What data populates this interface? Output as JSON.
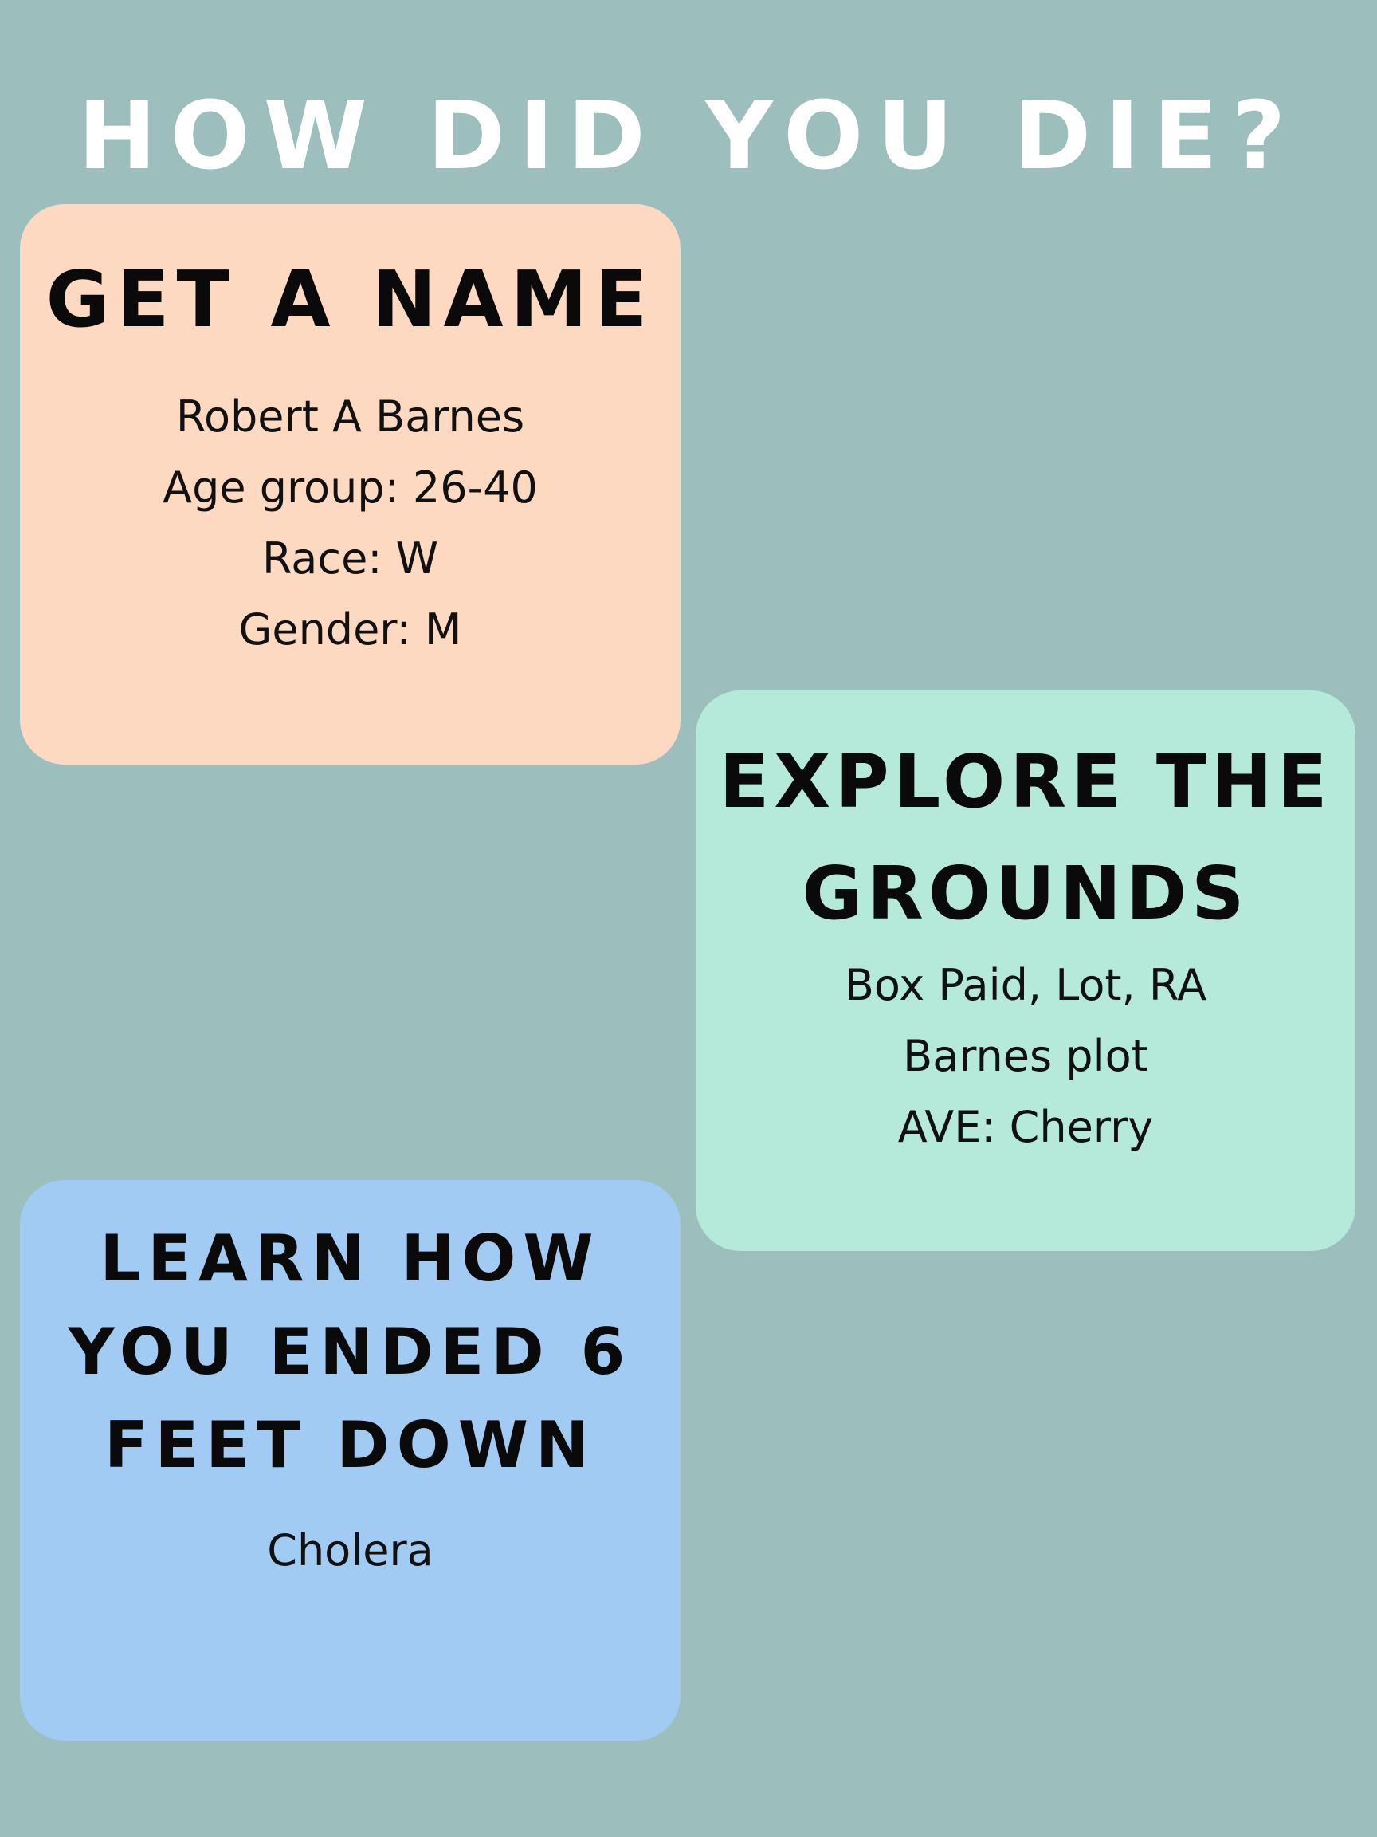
{
  "title": "HOW DID YOU DIE?",
  "cards": [
    {
      "heading": "GET A NAME",
      "lines": [
        "Robert A Barnes",
        "Age group: 26-40",
        "Race: W",
        "Gender: M"
      ],
      "color": "#fdd9c2"
    },
    {
      "heading": "EXPLORE THE\nGROUNDS",
      "lines": [
        "Box Paid, Lot, RA",
        "Barnes plot",
        "AVE: Cherry"
      ],
      "color": "#b5eadb"
    },
    {
      "heading": "LEARN HOW\nYOU ENDED 6\nFEET DOWN",
      "lines": [
        "Cholera"
      ],
      "color": "#a2cbf3"
    }
  ],
  "colors": {
    "background": "#9cbfbe",
    "title": "#ffffff",
    "text": "#0b0b0b"
  }
}
